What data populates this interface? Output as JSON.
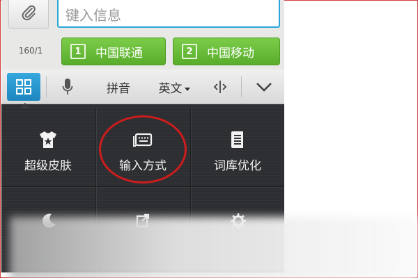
{
  "compose": {
    "input_placeholder": "键入信息",
    "char_counter": "160/1"
  },
  "sim_buttons": [
    {
      "number": "1",
      "label": "中国联通"
    },
    {
      "number": "2",
      "label": "中国移动"
    }
  ],
  "toolbar": {
    "menu_icon": "grid-menu-icon",
    "mic_icon": "microphone-icon",
    "pinyin_label": "拼音",
    "english_label": "英文",
    "cursor_icon": "cursor-move-icon",
    "collapse_icon": "chevron-down-icon"
  },
  "menu": {
    "items": [
      {
        "label": "超级皮肤",
        "icon": "tshirt-star-icon"
      },
      {
        "label": "输入方式",
        "icon": "keyboard-icon"
      },
      {
        "label": "词库优化",
        "icon": "dictionary-icon"
      }
    ],
    "row2_icons": [
      "moon-icon",
      "external-icon",
      "gear-icon"
    ]
  },
  "colors": {
    "accent_blue": "#2aa6d6",
    "sim_green": "#5cb531",
    "highlight_red": "#cc1d1d",
    "menu_bg": "#2f3033"
  }
}
